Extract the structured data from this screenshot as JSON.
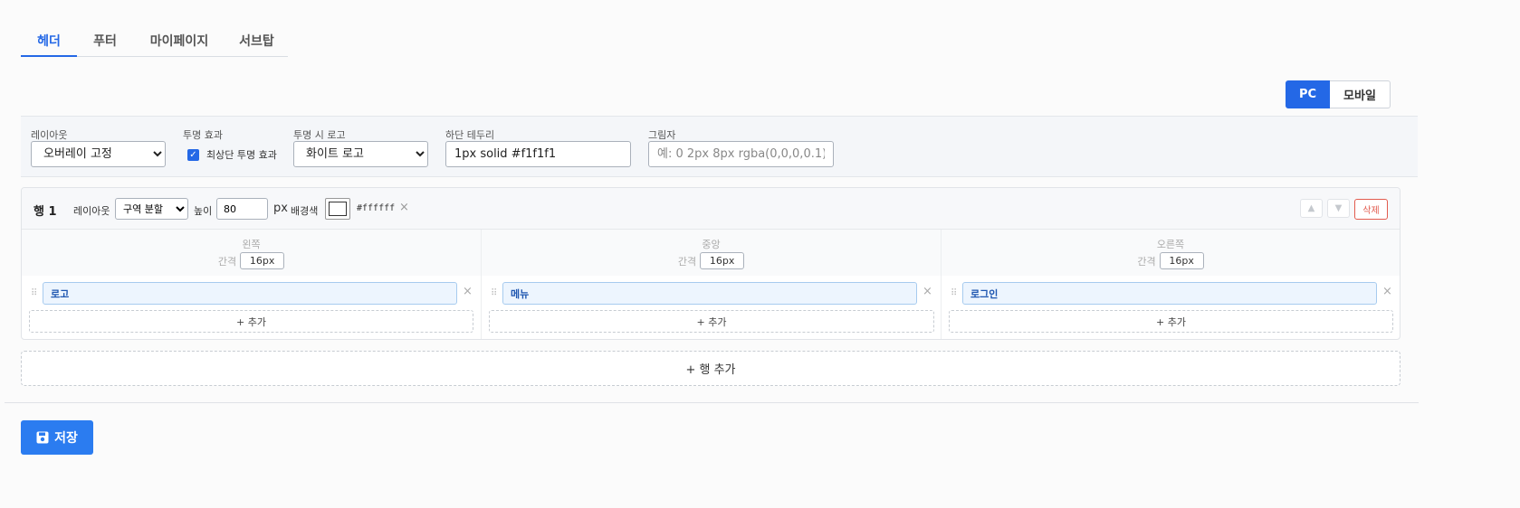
{
  "tabs": [
    {
      "label": "헤더",
      "active": true
    },
    {
      "label": "푸터",
      "active": false
    },
    {
      "label": "마이페이지",
      "active": false
    },
    {
      "label": "서브탑",
      "active": false
    }
  ],
  "device": {
    "pc": "PC",
    "mobile": "모바일",
    "selected": "PC"
  },
  "settings": {
    "layout": {
      "label": "레이아웃",
      "value": "오버레이 고정"
    },
    "transparency": {
      "label": "투명 효과",
      "checkbox_label": "최상단 투명 효과",
      "checked": true
    },
    "transparent_logo": {
      "label": "투명 시 로고",
      "value": "화이트 로고"
    },
    "bottom_border": {
      "label": "하단 테두리",
      "value": "1px solid #f1f1f1"
    },
    "shadow": {
      "label": "그림자",
      "value": "",
      "placeholder": "예: 0 2px 8px rgba(0,0,0,0.1)"
    }
  },
  "row": {
    "title": "행 1",
    "layout_label": "레이아웃",
    "layout_value": "구역 분할",
    "height_label": "높이",
    "height_value": "80",
    "height_unit": "px",
    "bg_label": "배경색",
    "bg_value": "#ffffff",
    "clear_icon": "×",
    "up_icon": "▲",
    "down_icon": "▼",
    "delete_label": "삭제",
    "columns": [
      {
        "name": "왼쪽",
        "gap_label": "간격",
        "gap_value": "16px",
        "item": "로고",
        "add_label": "+ 추가"
      },
      {
        "name": "중앙",
        "gap_label": "간격",
        "gap_value": "16px",
        "item": "메뉴",
        "add_label": "+ 추가"
      },
      {
        "name": "오른쪽",
        "gap_label": "간격",
        "gap_value": "16px",
        "item": "로그인",
        "add_label": "+ 추가"
      }
    ]
  },
  "add_row_label": "+ 행 추가",
  "save_label": "저장",
  "colors": {
    "accent": "#2468e6",
    "save": "#2b7cf0",
    "danger": "#e25b4e",
    "chip_bg": "#edf5fe"
  }
}
